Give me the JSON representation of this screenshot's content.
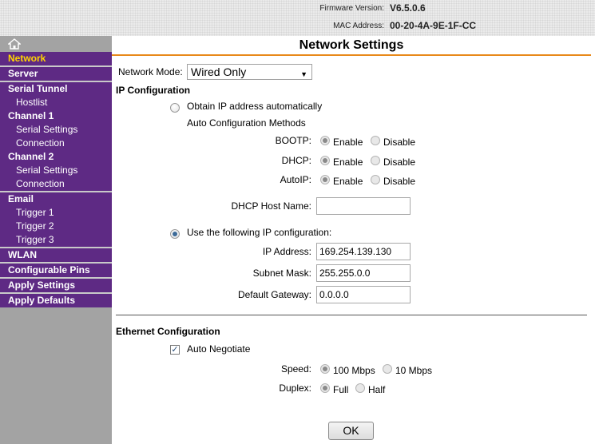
{
  "header": {
    "firmware_label": "Firmware Version:",
    "firmware_value": "V6.5.0.6",
    "mac_label": "MAC Address:",
    "mac_value": "00-20-4A-9E-1F-CC"
  },
  "sidebar": {
    "home_icon": "home-icon",
    "items": [
      {
        "label": "Network"
      },
      {
        "label": "Server"
      },
      {
        "label": "Serial Tunnel"
      },
      {
        "label": "Hostlist"
      },
      {
        "label": "Channel 1"
      },
      {
        "label": "Serial Settings"
      },
      {
        "label": "Connection"
      },
      {
        "label": "Channel 2"
      },
      {
        "label": "Serial Settings"
      },
      {
        "label": "Connection"
      },
      {
        "label": "Email"
      },
      {
        "label": "Trigger 1"
      },
      {
        "label": "Trigger 2"
      },
      {
        "label": "Trigger 3"
      },
      {
        "label": "WLAN"
      },
      {
        "label": "Configurable Pins"
      },
      {
        "label": "Apply Settings"
      },
      {
        "label": "Apply Defaults"
      }
    ],
    "active_color": "#ffd400",
    "bg_color": "#5e2a84"
  },
  "main": {
    "title": "Network Settings",
    "network_mode_label": "Network Mode:",
    "network_mode_value": "Wired Only",
    "ip_config_heading": "IP Configuration",
    "obtain_auto_label": "Obtain IP address automatically",
    "auto_methods_label": "Auto Configuration Methods",
    "bootp_label": "BOOTP:",
    "dhcp_label": "DHCP:",
    "autoip_label": "AutoIP:",
    "enable_label": "Enable",
    "disable_label": "Disable",
    "dhcp_host_label": "DHCP Host Name:",
    "dhcp_host_value": "",
    "use_following_label": "Use the following IP configuration:",
    "ip_address_label": "IP Address:",
    "ip_address_value": "169.254.139.130",
    "subnet_label": "Subnet Mask:",
    "subnet_value": "255.255.0.0",
    "gateway_label": "Default Gateway:",
    "gateway_value": "0.0.0.0",
    "ethernet_heading": "Ethernet Configuration",
    "auto_negotiate_label": "Auto Negotiate",
    "speed_label": "Speed:",
    "speed_100": "100 Mbps",
    "speed_10": "10 Mbps",
    "duplex_label": "Duplex:",
    "duplex_full": "Full",
    "duplex_half": "Half",
    "ok_label": "OK",
    "accent_color": "#e8891a"
  }
}
